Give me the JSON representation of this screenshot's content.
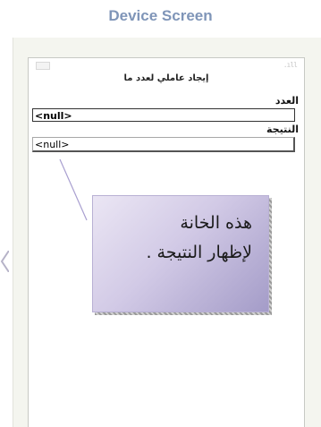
{
  "panel": {
    "title": "Device Screen"
  },
  "device": {
    "title": "إيجاد عاملي لعدد ما",
    "number_label": "العدد",
    "number_value": "<null>",
    "result_label": "النتيجة",
    "result_value": "<null>"
  },
  "callout": {
    "line1": "هذه الخانة",
    "line2": "لإظهار النتيجة ."
  },
  "colors": {
    "title": "#7f95b8",
    "panel_bg": "#f4f5ef",
    "callout_fill": "#d2cae6",
    "pointer_line": "#a99fd0"
  }
}
